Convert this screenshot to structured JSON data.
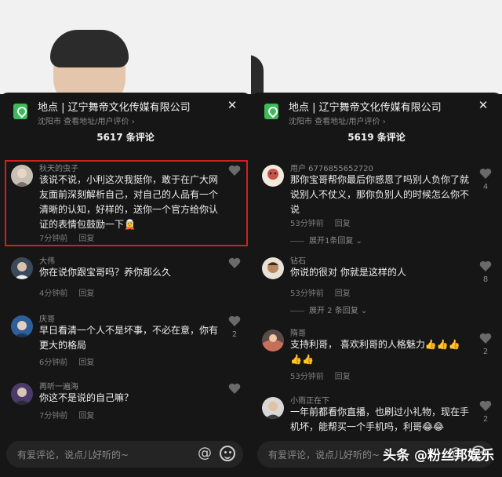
{
  "left": {
    "location": {
      "label": "地点",
      "name": "辽宁舞帝文化传媒有限公司",
      "sub": "沈阳市 查看地址/用户评价 ›"
    },
    "count": "5617 条评论",
    "comments": [
      {
        "user": "秋天的虫子",
        "text": "该说不说，小利这次我挺你，敢于在广大网友面前深刻解析自己，对自己的人品有一个清晰的认知，好样的，送你一个官方给你认证的表情包鼓励一下🧝",
        "time": "7分钟前",
        "reply": "回复",
        "likes": ""
      },
      {
        "user": "大伟",
        "text": "你在说你跟宝哥吗？养你那么久",
        "time": "4分钟前",
        "reply": "回复",
        "likes": ""
      },
      {
        "user": "庆哥",
        "text": "早日看清一个人不是坏事，不必在意，你有更大的格局",
        "time": "6分钟前",
        "reply": "回复",
        "likes": "2"
      },
      {
        "user": "再听一遍海",
        "text": "你这不是说的自己嘛？",
        "time": "7分钟前",
        "reply": "回复",
        "likes": ""
      }
    ],
    "input_placeholder": "有爱评论，说点儿好听的~"
  },
  "right": {
    "location": {
      "label": "地点",
      "name": "辽宁舞帝文化传媒有限公司",
      "sub": "沈阳市 查看地址/用户评价 ›"
    },
    "count": "5619 条评论",
    "comments": [
      {
        "user": "用户 6776855652720",
        "text": "那你宝哥帮你最后你感恩了吗别人负你了就说别人不仗义，那你负别人的时候怎么你不说",
        "time": "53分钟前",
        "reply": "回复",
        "likes": "4",
        "expand": "展开1条回复 ⌄"
      },
      {
        "user": "钻石",
        "text": "你说的很对 你就是这样的人",
        "time": "53分钟前",
        "reply": "回复",
        "likes": "8",
        "expand": "展开 2 条回复 ⌄"
      },
      {
        "user": "隋哥",
        "text": "支持利哥，  喜欢利哥的人格魅力👍👍👍👍👍",
        "time": "53分钟前",
        "reply": "回复",
        "likes": "2"
      },
      {
        "user": "小雨正在下",
        "text": "一年前都看你直播，也刷过小礼物，现在手机坏，能帮买一个手机吗，利哥😂😂",
        "time": "",
        "reply": "",
        "likes": "2"
      }
    ],
    "input_placeholder": "有爱评论，说点儿好听的~"
  },
  "watermark": "头条 @粉丝邦娱乐",
  "colors": {
    "highlight": "#d21f1f",
    "location_icon": "#3dba5a"
  }
}
